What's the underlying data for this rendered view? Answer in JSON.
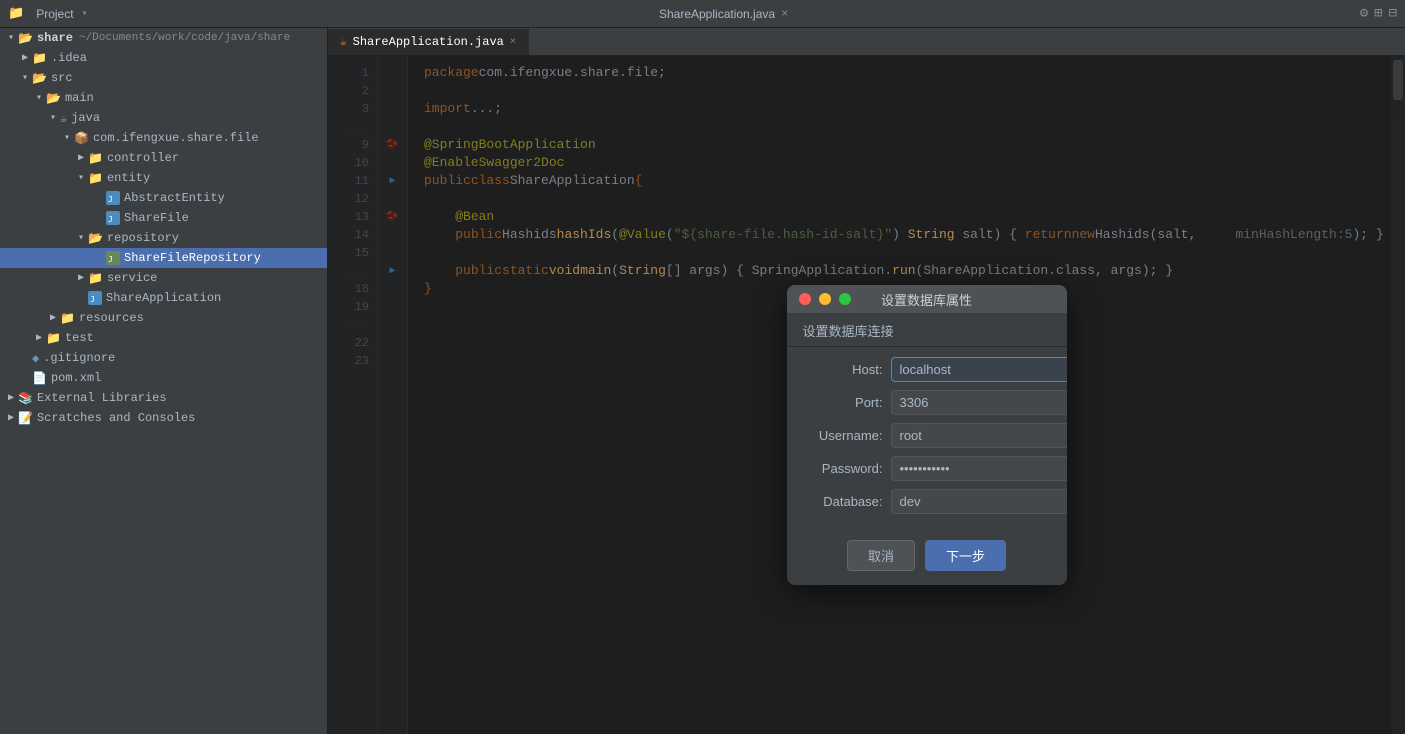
{
  "titlebar": {
    "project_label": "Project",
    "dropdown_arrow": "▾",
    "settings_icon": "⚙",
    "icons": [
      "⚙",
      "⊞",
      "⊟"
    ]
  },
  "tab": {
    "label": "ShareApplication.java",
    "close": "×"
  },
  "sidebar": {
    "header": "Project",
    "tree": [
      {
        "id": "share",
        "label": "share",
        "path": "~/Documents/work/code/java/share",
        "indent": 0,
        "expanded": true,
        "type": "project"
      },
      {
        "id": "idea",
        "label": ".idea",
        "indent": 1,
        "expanded": false,
        "type": "folder"
      },
      {
        "id": "src",
        "label": "src",
        "indent": 1,
        "expanded": true,
        "type": "folder"
      },
      {
        "id": "main",
        "label": "main",
        "indent": 2,
        "expanded": true,
        "type": "folder"
      },
      {
        "id": "java",
        "label": "java",
        "indent": 3,
        "expanded": true,
        "type": "java-folder"
      },
      {
        "id": "com",
        "label": "com.ifengxue.share.file",
        "indent": 4,
        "expanded": true,
        "type": "package"
      },
      {
        "id": "controller",
        "label": "controller",
        "indent": 5,
        "expanded": false,
        "type": "folder"
      },
      {
        "id": "entity",
        "label": "entity",
        "indent": 5,
        "expanded": true,
        "type": "folder"
      },
      {
        "id": "AbstractEntity",
        "label": "AbstractEntity",
        "indent": 6,
        "expanded": false,
        "type": "java-file"
      },
      {
        "id": "ShareFile",
        "label": "ShareFile",
        "indent": 6,
        "expanded": false,
        "type": "java-file-blue"
      },
      {
        "id": "repository",
        "label": "repository",
        "indent": 5,
        "expanded": true,
        "type": "folder"
      },
      {
        "id": "ShareFileRepository",
        "label": "ShareFileRepository",
        "indent": 6,
        "expanded": false,
        "type": "java-file-blue",
        "selected": true
      },
      {
        "id": "service",
        "label": "service",
        "indent": 5,
        "expanded": false,
        "type": "folder"
      },
      {
        "id": "ShareApplication",
        "label": "ShareApplication",
        "indent": 6,
        "expanded": false,
        "type": "java-file-blue"
      },
      {
        "id": "resources",
        "label": "resources",
        "indent": 3,
        "expanded": false,
        "type": "folder"
      },
      {
        "id": "test",
        "label": "test",
        "indent": 2,
        "expanded": false,
        "type": "folder"
      },
      {
        "id": "gitignore",
        "label": ".gitignore",
        "indent": 1,
        "expanded": false,
        "type": "gitignore"
      },
      {
        "id": "pom",
        "label": "pom.xml",
        "indent": 1,
        "expanded": false,
        "type": "xml"
      },
      {
        "id": "external",
        "label": "External Libraries",
        "indent": 0,
        "expanded": false,
        "type": "library"
      },
      {
        "id": "scratches",
        "label": "Scratches and Consoles",
        "indent": 0,
        "expanded": false,
        "type": "scratches"
      }
    ]
  },
  "editor": {
    "tab_label": "ShareApplication.java",
    "lines": [
      {
        "num": 1,
        "gutter": "",
        "code": "package com.ifengxue.share.file;"
      },
      {
        "num": 2,
        "gutter": "",
        "code": ""
      },
      {
        "num": 3,
        "gutter": "",
        "code": "import ...;"
      },
      {
        "num": 9,
        "gutter": "",
        "code": ""
      },
      {
        "num": 10,
        "gutter": "bean",
        "code": "@SpringBootApplication"
      },
      {
        "num": 11,
        "gutter": "",
        "code": "@EnableSwagger2Doc"
      },
      {
        "num": 12,
        "gutter": "run",
        "code": "public class ShareApplication {"
      },
      {
        "num": 13,
        "gutter": "",
        "code": ""
      },
      {
        "num": 14,
        "gutter": "bean",
        "code": "    @Bean"
      },
      {
        "num": 15,
        "gutter": "",
        "code": "    public Hashids hashIds(@Value(\"${share-file.hash-id-salt}\") String salt) { return new Hashids(salt,    minHashLength: 5); }"
      },
      {
        "num": 18,
        "gutter": "",
        "code": ""
      },
      {
        "num": 19,
        "gutter": "run",
        "code": "    public static void main(String[] args) { SpringApplication.run(ShareApplication.class, args); }"
      },
      {
        "num": 22,
        "gutter": "",
        "code": "}"
      },
      {
        "num": 23,
        "gutter": "",
        "code": ""
      }
    ]
  },
  "modal": {
    "title": "设置数据库属性",
    "subtitle": "设置数据库连接",
    "fields": [
      {
        "label": "Host:",
        "value": "localhost",
        "type": "text",
        "focused": true
      },
      {
        "label": "Port:",
        "value": "3306",
        "type": "text",
        "focused": false
      },
      {
        "label": "Username:",
        "value": "root",
        "type": "text",
        "focused": false
      },
      {
        "label": "Password:",
        "value": "●●●●●●●●●●●●●●●●●●",
        "type": "password",
        "focused": false
      },
      {
        "label": "Database:",
        "value": "dev",
        "type": "text",
        "focused": false
      }
    ],
    "buttons": [
      {
        "label": "取消",
        "type": "cancel"
      },
      {
        "label": "下一步",
        "type": "primary"
      }
    ],
    "traffic_lights": [
      "red",
      "yellow",
      "green"
    ]
  }
}
